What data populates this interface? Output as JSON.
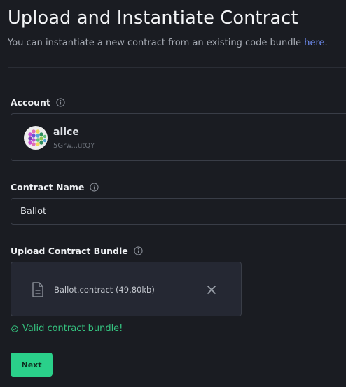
{
  "header": {
    "title": "Upload and Instantiate Contract",
    "subtitle_text": "You can instantiate a new contract from an existing code bundle",
    "subtitle_link": "here",
    "subtitle_suffix": "."
  },
  "account": {
    "label": "Account",
    "name": "alice",
    "address": "5Grw...utQY"
  },
  "contract_name": {
    "label": "Contract Name",
    "value": "Ballot"
  },
  "upload": {
    "label": "Upload Contract Bundle",
    "file_name": "Ballot.contract (49.80kb)"
  },
  "validation": {
    "message": "Valid contract bundle!"
  },
  "actions": {
    "next_label": "Next"
  },
  "colors": {
    "background": "#1a1c22",
    "link": "#6f8df3",
    "success": "#35c27f",
    "button": "#2ad08a"
  }
}
